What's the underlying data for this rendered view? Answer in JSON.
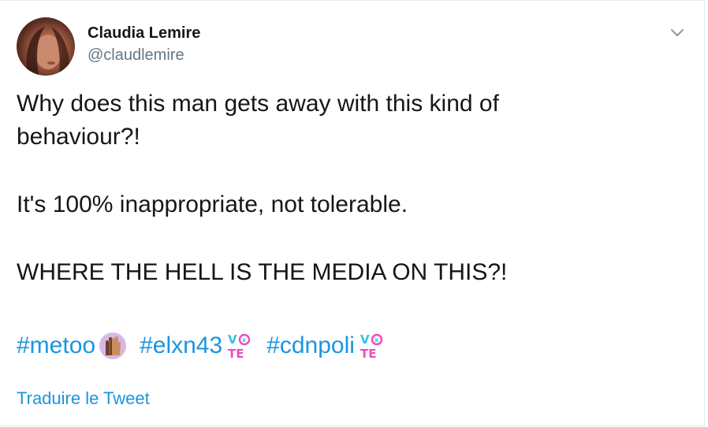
{
  "author": {
    "name": "Claudia Lemire",
    "handle": "@claudlemire"
  },
  "tweet": {
    "lines": [
      "Why does this man gets away with this kind of",
      "behaviour?!",
      "It's 100% inappropriate, not tolerable.",
      "WHERE THE HELL IS THE MEDIA ON THIS?!"
    ],
    "hashtags": [
      "#metoo",
      "#elxn43",
      "#cdnpoli"
    ],
    "hashtag_emojis": [
      "raised-hands-emoji",
      "vote-badge-emoji",
      "vote-badge-emoji"
    ]
  },
  "actions": {
    "translate_label": "Traduire le Tweet",
    "menu_icon": "chevron-down-icon"
  },
  "colors": {
    "link": "#1b95e0",
    "text": "#14171a",
    "secondary_text": "#657786",
    "border": "#e6ecf0",
    "vote_blue": "#33c2e8",
    "vote_pink": "#e84fbf"
  }
}
